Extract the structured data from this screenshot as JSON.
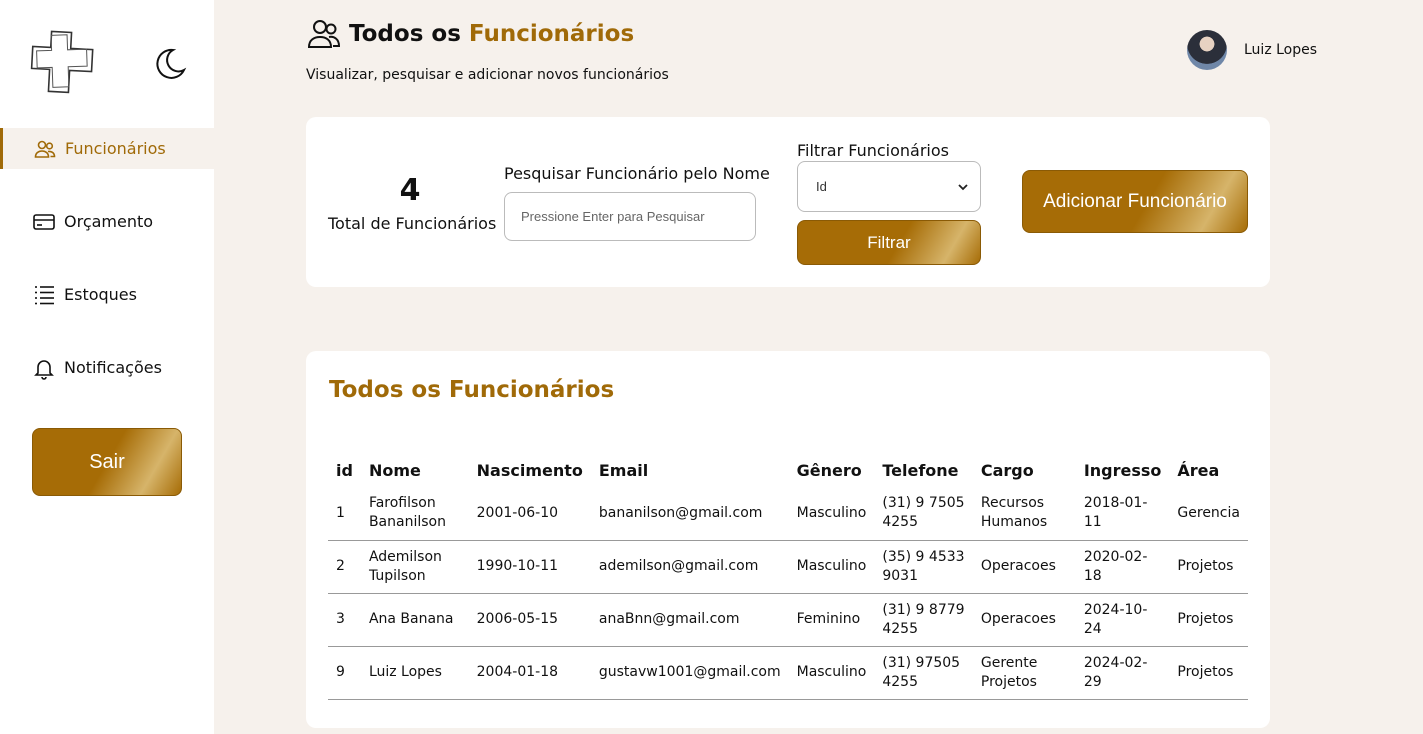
{
  "sidebar": {
    "items": [
      {
        "label": "Funcionários",
        "icon": "users-icon",
        "active": true
      },
      {
        "label": "Orçamento",
        "icon": "credit-card-icon",
        "active": false
      },
      {
        "label": "Estoques",
        "icon": "list-icon",
        "active": false
      },
      {
        "label": "Notificações",
        "icon": "bell-icon",
        "active": false
      }
    ],
    "logout_label": "Sair"
  },
  "header": {
    "title_plain": "Todos os",
    "title_accent": "Funcionários",
    "subtitle": "Visualizar, pesquisar e adicionar novos funcionários"
  },
  "user": {
    "name": "Luiz Lopes"
  },
  "summary": {
    "total": "4",
    "total_label": "Total de Funcionários",
    "search_label": "Pesquisar Funcionário pelo Nome",
    "search_placeholder": "Pressione Enter para Pesquisar",
    "filter_label": "Filtrar Funcionários",
    "filter_value": "Id",
    "filter_button": "Filtrar",
    "add_button": "Adicionar Funcionário"
  },
  "table": {
    "title": "Todos os Funcionários",
    "headers": [
      "id",
      "Nome",
      "Nascimento",
      "Email",
      "Gênero",
      "Telefone",
      "Cargo",
      "Ingresso",
      "Área"
    ],
    "rows": [
      [
        "1",
        "Farofilson Bananilson",
        "2001-06-10",
        "bananilson@gmail.com",
        "Masculino",
        "(31) 9 7505 4255",
        "Recursos Humanos",
        "2018-01-11",
        "Gerencia"
      ],
      [
        "2",
        "Ademilson Tupilson",
        "1990-10-11",
        "ademilson@gmail.com",
        "Masculino",
        "(35) 9 4533 9031",
        "Operacoes",
        "2020-02-18",
        "Projetos"
      ],
      [
        "3",
        "Ana Banana",
        "2006-05-15",
        "anaBnn@gmail.com",
        "Feminino",
        "(31) 9 8779 4255",
        "Operacoes",
        "2024-10-24",
        "Projetos"
      ],
      [
        "9",
        "Luiz Lopes",
        "2004-01-18",
        "gustavw1001@gmail.com",
        "Masculino",
        "(31) 97505 4255",
        "Gerente Projetos",
        "2024-02-29",
        "Projetos"
      ]
    ]
  },
  "colors": {
    "accent": "#a06a08",
    "background": "#f6f1ec"
  }
}
